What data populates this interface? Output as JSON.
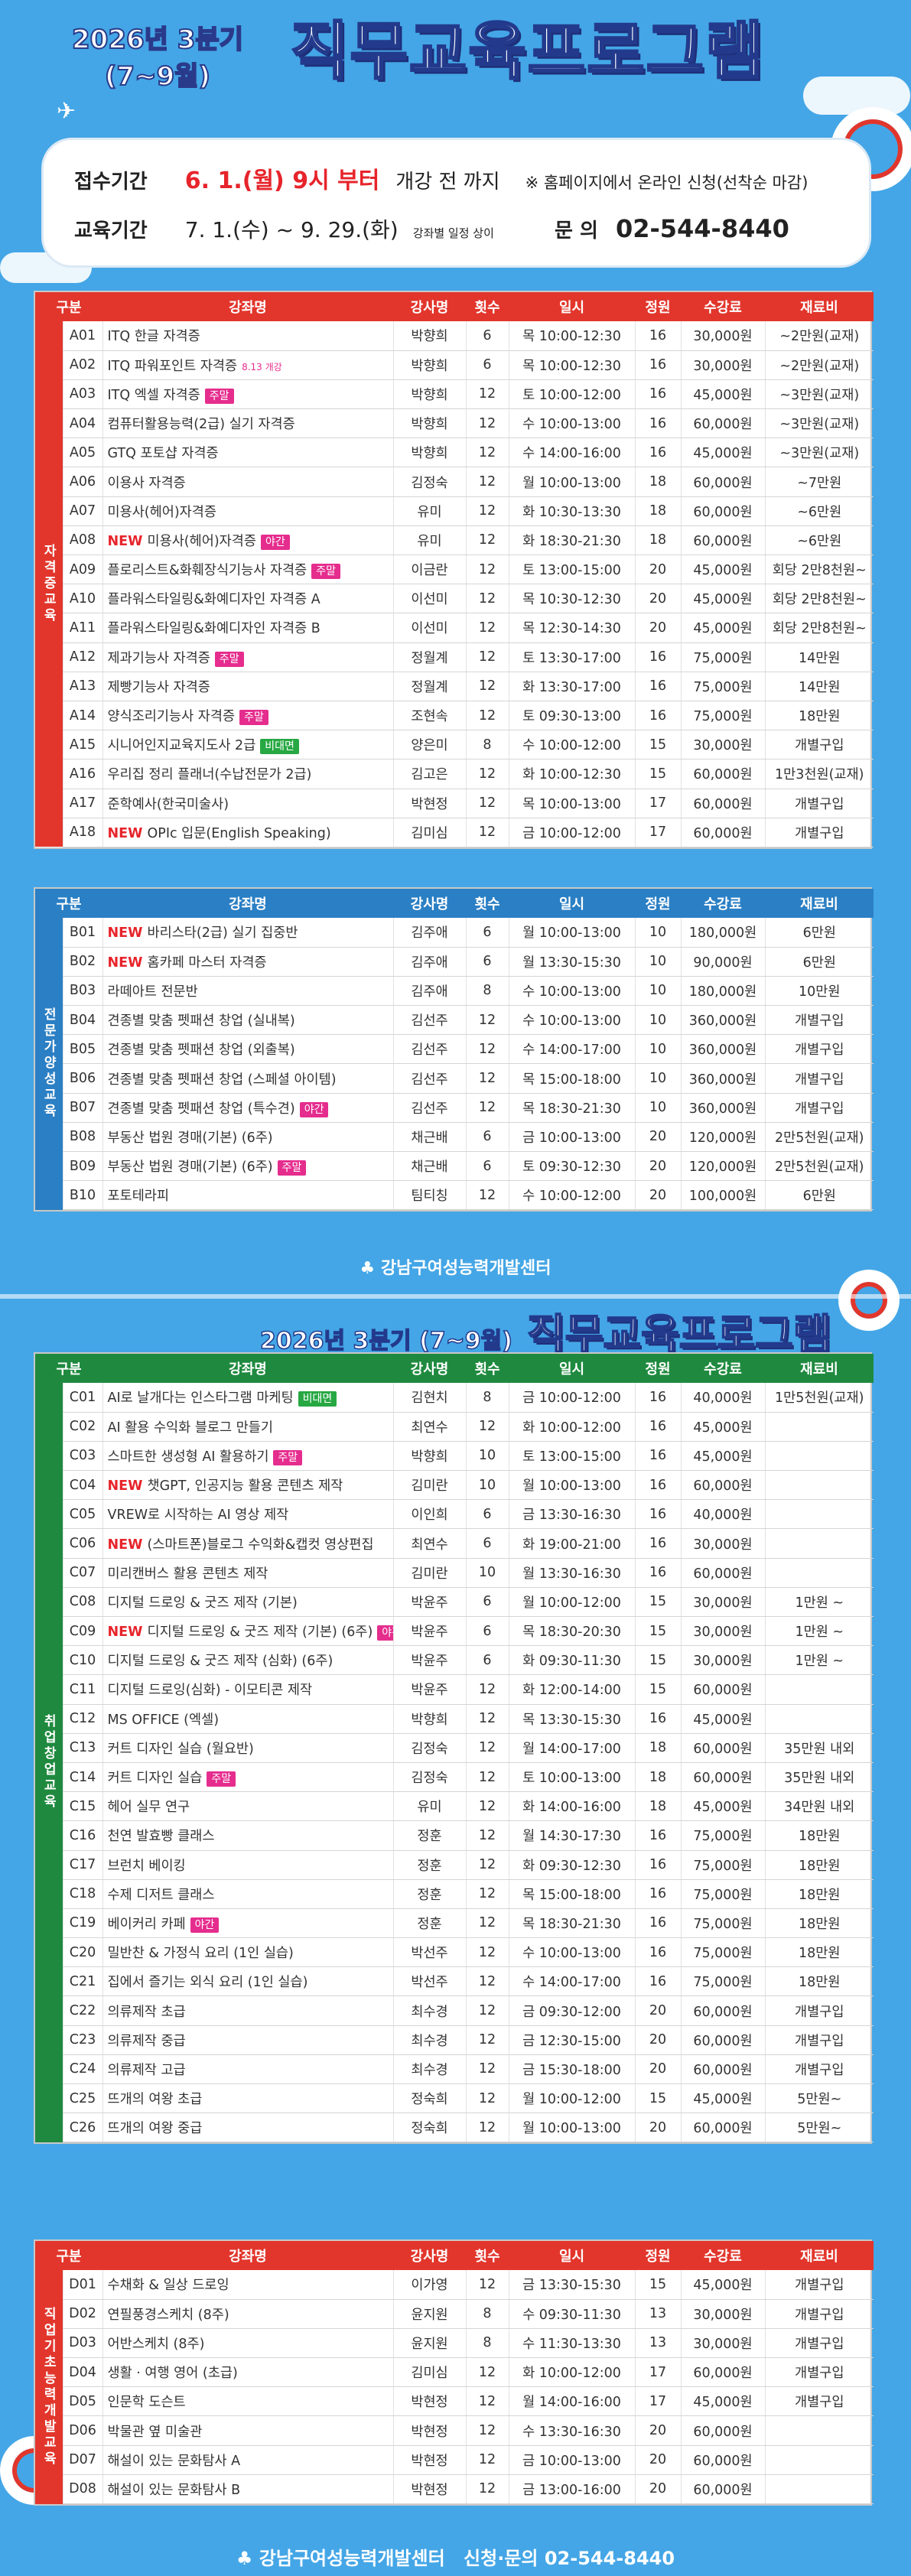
{
  "header": {
    "small_title_1": "2026년 3분기",
    "small_title_2": "(7~9월)",
    "big_title": "직무교육프로그램"
  },
  "info": {
    "reception_label": "접수기간",
    "reception_date": "6. 1.(월) 9시 부터",
    "reception_suffix": "개강 전 까지",
    "reception_note": "※ 홈페이지에서 온라인 신청(선착순 마감)",
    "edu_label": "교육기간",
    "edu_dates": "7. 1.(수) ~ 9. 29.(화)",
    "edu_note": "강좌별 일정 상이",
    "inquiry_label": "문  의",
    "inquiry_phone": "02-544-8440"
  },
  "columns": [
    "구분",
    "강좌명",
    "강사명",
    "횟수",
    "일시",
    "정원",
    "수강료",
    "재료비"
  ],
  "sectionA": {
    "name": "자격증교육",
    "color": "#e2362c",
    "rows": [
      [
        "A01",
        "ITQ 한글 자격증",
        "",
        "",
        "박향희",
        "6",
        "목 10:00-12:30",
        "16",
        "30,000원",
        "~2만원(교재)"
      ],
      [
        "A02",
        "ITQ 파워포인트 자격증",
        "",
        "8.13 개강",
        "박향희",
        "6",
        "목 10:00-12:30",
        "16",
        "30,000원",
        "~2만원(교재)"
      ],
      [
        "A03",
        "ITQ 엑셀 자격증",
        "",
        "주말",
        "박향희",
        "12",
        "토 10:00-12:00",
        "16",
        "45,000원",
        "~3만원(교재)"
      ],
      [
        "A04",
        "컴퓨터활용능력(2급) 실기 자격증",
        "",
        "",
        "박향희",
        "12",
        "수 10:00-13:00",
        "16",
        "60,000원",
        "~3만원(교재)"
      ],
      [
        "A05",
        "GTQ 포토샵 자격증",
        "",
        "",
        "박향희",
        "12",
        "수 14:00-16:00",
        "16",
        "45,000원",
        "~3만원(교재)"
      ],
      [
        "A06",
        "이용사 자격증",
        "",
        "",
        "김정숙",
        "12",
        "월 10:00-13:00",
        "18",
        "60,000원",
        "~7만원"
      ],
      [
        "A07",
        "미용사(헤어)자격증",
        "",
        "",
        "유미",
        "12",
        "화 10:30-13:30",
        "18",
        "60,000원",
        "~6만원"
      ],
      [
        "A08",
        "미용사(헤어)자격증",
        "NEW",
        "야간",
        "유미",
        "12",
        "화 18:30-21:30",
        "18",
        "60,000원",
        "~6만원"
      ],
      [
        "A09",
        "플로리스트&화훼장식기능사 자격증",
        "",
        "주말",
        "이금란",
        "12",
        "토 13:00-15:00",
        "20",
        "45,000원",
        "회당 2만8천원~"
      ],
      [
        "A10",
        "플라워스타일링&화예디자인 자격증 A",
        "",
        "",
        "이선미",
        "12",
        "목 10:30-12:30",
        "20",
        "45,000원",
        "회당 2만8천원~"
      ],
      [
        "A11",
        "플라워스타일링&화예디자인 자격증 B",
        "",
        "",
        "이선미",
        "12",
        "목 12:30-14:30",
        "20",
        "45,000원",
        "회당 2만8천원~"
      ],
      [
        "A12",
        "제과기능사 자격증",
        "",
        "주말",
        "정월계",
        "12",
        "토 13:30-17:00",
        "16",
        "75,000원",
        "14만원"
      ],
      [
        "A13",
        "제빵기능사 자격증",
        "",
        "",
        "정월계",
        "12",
        "화 13:30-17:00",
        "16",
        "75,000원",
        "14만원"
      ],
      [
        "A14",
        "양식조리기능사 자격증",
        "",
        "주말",
        "조현속",
        "12",
        "토 09:30-13:00",
        "16",
        "75,000원",
        "18만원"
      ],
      [
        "A15",
        "시니어인지교육지도사 2급",
        "",
        "비대면",
        "양은미",
        "8",
        "수 10:00-12:00",
        "15",
        "30,000원",
        "개별구입"
      ],
      [
        "A16",
        "우리집 정리 플래너(수납전문가 2급)",
        "",
        "",
        "김고은",
        "12",
        "화 10:00-12:30",
        "15",
        "60,000원",
        "1만3천원(교재)"
      ],
      [
        "A17",
        "준학예사(한국미술사)",
        "",
        "",
        "박현정",
        "12",
        "목 10:00-13:00",
        "17",
        "60,000원",
        "개별구입"
      ],
      [
        "A18",
        "OPIc 입문(English Speaking)",
        "NEW",
        "",
        "김미심",
        "12",
        "금 10:00-12:00",
        "17",
        "60,000원",
        "개별구입"
      ]
    ]
  },
  "sectionB": {
    "name": "전문가양성교육",
    "color": "#2b7fc4",
    "rows": [
      [
        "B01",
        "바리스타(2급) 실기 집중반",
        "NEW",
        "",
        "김주애",
        "6",
        "월 10:00-13:00",
        "10",
        "180,000원",
        "6만원"
      ],
      [
        "B02",
        "홈카페 마스터 자격증",
        "NEW",
        "",
        "김주애",
        "6",
        "월 13:30-15:30",
        "10",
        "90,000원",
        "6만원"
      ],
      [
        "B03",
        "라떼아트 전문반",
        "",
        "",
        "김주애",
        "8",
        "수 10:00-13:00",
        "10",
        "180,000원",
        "10만원"
      ],
      [
        "B04",
        "견종별 맞춤 펫패션 창업 (실내복)",
        "",
        "",
        "김선주",
        "12",
        "수 10:00-13:00",
        "10",
        "360,000원",
        "개별구입"
      ],
      [
        "B05",
        "견종별 맞춤 펫패션 창업 (외출복)",
        "",
        "",
        "김선주",
        "12",
        "수 14:00-17:00",
        "10",
        "360,000원",
        "개별구입"
      ],
      [
        "B06",
        "견종별 맞춤 펫패션 창업 (스페셜 아이템)",
        "",
        "",
        "김선주",
        "12",
        "목 15:00-18:00",
        "10",
        "360,000원",
        "개별구입"
      ],
      [
        "B07",
        "견종별 맞춤 펫패션 창업 (특수견)",
        "",
        "야간",
        "김선주",
        "12",
        "목 18:30-21:30",
        "10",
        "360,000원",
        "개별구입"
      ],
      [
        "B08",
        "부동산 법원 경매(기본) (6주)",
        "",
        "",
        "채근배",
        "6",
        "금 10:00-13:00",
        "20",
        "120,000원",
        "2만5천원(교재)"
      ],
      [
        "B09",
        "부동산 법원 경매(기본) (6주)",
        "",
        "주말",
        "채근배",
        "6",
        "토 09:30-12:30",
        "20",
        "120,000원",
        "2만5천원(교재)"
      ],
      [
        "B10",
        "포토테라피",
        "",
        "",
        "팀티칭",
        "12",
        "수 10:00-12:00",
        "20",
        "100,000원",
        "6만원"
      ]
    ]
  },
  "center_name": "강남구여성능력개발센터",
  "header2": {
    "title_small": "2026년 3분기 (7~9월)",
    "title_big": "직무교육프로그램"
  },
  "sectionC": {
    "name": "취업창업교육",
    "color": "#1f8a3f",
    "rows": [
      [
        "C01",
        "AI로 날개다는 인스타그램 마케팅",
        "",
        "비대면",
        "김현치",
        "8",
        "금 10:00-12:00",
        "16",
        "40,000원",
        "1만5천원(교재)"
      ],
      [
        "C02",
        "AI 활용 수익화 블로그 만들기",
        "",
        "",
        "최연수",
        "12",
        "화 10:00-12:00",
        "16",
        "45,000원",
        ""
      ],
      [
        "C03",
        "스마트한 생성형 AI 활용하기",
        "",
        "주말",
        "박향희",
        "10",
        "토 13:00-15:00",
        "16",
        "45,000원",
        ""
      ],
      [
        "C04",
        "챗GPT, 인공지능 활용 콘텐츠 제작",
        "NEW",
        "",
        "김미란",
        "10",
        "월 10:00-13:00",
        "16",
        "60,000원",
        ""
      ],
      [
        "C05",
        "VREW로 시작하는 AI 영상 제작",
        "",
        "",
        "이인희",
        "6",
        "금 13:30-16:30",
        "16",
        "40,000원",
        ""
      ],
      [
        "C06",
        "(스마트폰)블로그 수익화&캡컷 영상편집",
        "NEW",
        "",
        "최연수",
        "6",
        "화 19:00-21:00",
        "16",
        "30,000원",
        ""
      ],
      [
        "C07",
        "미리캔버스 활용 콘텐츠 제작",
        "",
        "",
        "김미란",
        "10",
        "월 13:30-16:30",
        "16",
        "60,000원",
        ""
      ],
      [
        "C08",
        "디지털 드로잉 & 굿즈 제작 (기본)",
        "",
        "",
        "박윤주",
        "6",
        "월 10:00-12:00",
        "15",
        "30,000원",
        "1만원 ~"
      ],
      [
        "C09",
        "디지털 드로잉 & 굿즈 제작 (기본) (6주)",
        "NEW",
        "야간",
        "박윤주",
        "6",
        "목 18:30-20:30",
        "15",
        "30,000원",
        "1만원 ~"
      ],
      [
        "C10",
        "디지털 드로잉 & 굿즈 제작 (심화) (6주)",
        "",
        "",
        "박윤주",
        "6",
        "화 09:30-11:30",
        "15",
        "30,000원",
        "1만원 ~"
      ],
      [
        "C11",
        "디지털 드로잉(심화) - 이모티콘 제작",
        "",
        "",
        "박윤주",
        "12",
        "화 12:00-14:00",
        "15",
        "60,000원",
        ""
      ],
      [
        "C12",
        "MS OFFICE (엑셀)",
        "",
        "",
        "박향희",
        "12",
        "목 13:30-15:30",
        "16",
        "45,000원",
        ""
      ],
      [
        "C13",
        "커트 디자인 실습 (월요반)",
        "",
        "",
        "김정숙",
        "12",
        "월 14:00-17:00",
        "18",
        "60,000원",
        "35만원 내외"
      ],
      [
        "C14",
        "커트 디자인 실습",
        "",
        "주말",
        "김정숙",
        "12",
        "토 10:00-13:00",
        "18",
        "60,000원",
        "35만원 내외"
      ],
      [
        "C15",
        "헤어 실무 연구",
        "",
        "",
        "유미",
        "12",
        "화 14:00-16:00",
        "18",
        "45,000원",
        "34만원 내외"
      ],
      [
        "C16",
        "천연 발효빵 클래스",
        "",
        "",
        "정훈",
        "12",
        "월 14:30-17:30",
        "16",
        "75,000원",
        "18만원"
      ],
      [
        "C17",
        "브런치 베이킹",
        "",
        "",
        "정훈",
        "12",
        "화 09:30-12:30",
        "16",
        "75,000원",
        "18만원"
      ],
      [
        "C18",
        "수제 디저트 클래스",
        "",
        "",
        "정훈",
        "12",
        "목 15:00-18:00",
        "16",
        "75,000원",
        "18만원"
      ],
      [
        "C19",
        "베이커리 카페",
        "",
        "야간",
        "정훈",
        "12",
        "목 18:30-21:30",
        "16",
        "75,000원",
        "18만원"
      ],
      [
        "C20",
        "밀반찬 & 가정식 요리 (1인 실습)",
        "",
        "",
        "박선주",
        "12",
        "수 10:00-13:00",
        "16",
        "75,000원",
        "18만원"
      ],
      [
        "C21",
        "집에서 즐기는 외식 요리 (1인 실습)",
        "",
        "",
        "박선주",
        "12",
        "수 14:00-17:00",
        "16",
        "75,000원",
        "18만원"
      ],
      [
        "C22",
        "의류제작 초급",
        "",
        "",
        "최수경",
        "12",
        "금 09:30-12:00",
        "20",
        "60,000원",
        "개별구입"
      ],
      [
        "C23",
        "의류제작 중급",
        "",
        "",
        "최수경",
        "12",
        "금 12:30-15:00",
        "20",
        "60,000원",
        "개별구입"
      ],
      [
        "C24",
        "의류제작 고급",
        "",
        "",
        "최수경",
        "12",
        "금 15:30-18:00",
        "20",
        "60,000원",
        "개별구입"
      ],
      [
        "C25",
        "뜨개의 여왕 초급",
        "",
        "",
        "정숙희",
        "12",
        "월 10:00-12:00",
        "15",
        "45,000원",
        "5만원~"
      ],
      [
        "C26",
        "뜨개의 여왕 중급",
        "",
        "",
        "정숙희",
        "12",
        "월 10:00-13:00",
        "20",
        "60,000원",
        "5만원~"
      ]
    ]
  },
  "sectionD": {
    "name": "직업기초능력개발교육",
    "color": "#e2362c",
    "rows": [
      [
        "D01",
        "수채화 & 일상 드로잉",
        "",
        "",
        "이가영",
        "12",
        "금 13:30-15:30",
        "15",
        "45,000원",
        "개별구입"
      ],
      [
        "D02",
        "연필풍경스케치 (8주)",
        "",
        "",
        "윤지원",
        "8",
        "수 09:30-11:30",
        "13",
        "30,000원",
        "개별구입"
      ],
      [
        "D03",
        "어반스케치 (8주)",
        "",
        "",
        "윤지원",
        "8",
        "수 11:30-13:30",
        "13",
        "30,000원",
        "개별구입"
      ],
      [
        "D04",
        "생활 · 여행 영어 (초급)",
        "",
        "",
        "김미심",
        "12",
        "화 10:00-12:00",
        "17",
        "60,000원",
        "개별구입"
      ],
      [
        "D05",
        "인문학 도슨트",
        "",
        "",
        "박현정",
        "12",
        "월 14:00-16:00",
        "17",
        "45,000원",
        "개별구입"
      ],
      [
        "D06",
        "박물관 옆 미술관",
        "",
        "",
        "박현정",
        "12",
        "수 13:30-16:30",
        "20",
        "60,000원",
        ""
      ],
      [
        "D07",
        "해설이 있는 문화탐사 A",
        "",
        "",
        "박현정",
        "12",
        "금 10:00-13:00",
        "20",
        "60,000원",
        ""
      ],
      [
        "D08",
        "해설이 있는 문화탐사 B",
        "",
        "",
        "박현정",
        "12",
        "금 13:00-16:00",
        "20",
        "60,000원",
        ""
      ]
    ]
  },
  "footer": {
    "center": "강남구여성능력개발센터",
    "contact": "신청·문의 02-544-8440"
  }
}
